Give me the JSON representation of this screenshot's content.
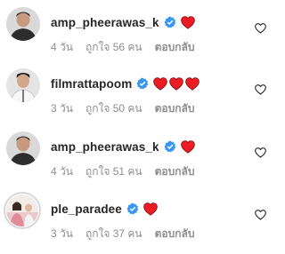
{
  "comments": [
    {
      "username": "amp_pheerawas_k",
      "hearts": 1,
      "time": "4 วัน",
      "likes": "ถูกใจ 56 คน",
      "reply": "ตอบกลับ",
      "avatar": "man-dark-shirt"
    },
    {
      "username": "filmrattapoom",
      "hearts": 3,
      "time": "3 วัน",
      "likes": "ถูกใจ 50 คน",
      "reply": "ตอบกลับ",
      "avatar": "man-white-shirt"
    },
    {
      "username": "amp_pheerawas_k",
      "hearts": 1,
      "time": "4 วัน",
      "likes": "ถูกใจ 51 คน",
      "reply": "ตอบกลับ",
      "avatar": "man-dark-shirt"
    },
    {
      "username": "ple_paradee",
      "hearts": 1,
      "time": "3 วัน",
      "likes": "ถูกใจ 37 คน",
      "reply": "ตอบกลับ",
      "avatar": "woman-with-story-ring"
    }
  ],
  "icons": {
    "verified": "verified-badge-icon",
    "like": "heart-outline-icon",
    "emoji": "red-heart-emoji"
  },
  "colors": {
    "verified": "#3897f0",
    "heart": "#ed1c24",
    "muted": "#8e8e8e",
    "text": "#262626"
  }
}
